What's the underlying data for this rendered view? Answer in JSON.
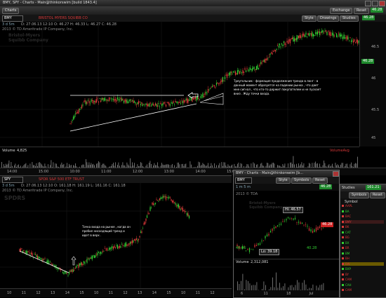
{
  "main_window": {
    "title": "BMY, SPY - Charts - Main@thinkorswim [build 1843.4]",
    "tab_symbol": "BRISTOL MYERS SQUIBB CO",
    "buttons": {
      "exchange": "Exchange",
      "style": "Style",
      "drawings": "Drawings",
      "studies": "Studies"
    },
    "price": "46.28"
  },
  "top_chart": {
    "symbol": "BMY",
    "interval": "3 d 5m",
    "ohlc": "D: 27.06.13 12:10   O: 46.27   H: 46.33   L: 46.27   C: 46.28",
    "copyright": "2013 © TD Ameritrade IP Company, Inc.",
    "watermark_lines": [
      "Bristol-Myers",
      "Squibb Company"
    ],
    "price_scale": [
      "46.5",
      "46",
      "45.5",
      "45",
      "44.5"
    ],
    "price_label": "46.28",
    "volume_label": "Volume",
    "volume_value": "4,825",
    "volume_right": "VolumeAvg",
    "time_axis": [
      "14:00",
      "15:00",
      "10:00",
      "11:00",
      "12:00",
      "13:00",
      "14:00",
      "15:00",
      "27",
      "10:00",
      "11:00"
    ],
    "annotation": "Треугольник - формация продолжения тренда в лонг - в данный момент образуется на падении рынка , что дает мне сигнал , что кто-то держит покупателем и не пускает вниз . Жду точки входа."
  },
  "bottom_chart": {
    "symbol": "SPY",
    "interval": "3 d 5m",
    "tab_symbol": "SPDR S&P 500 ETF TRUST",
    "ohlc": "D: 27.06.13 12:10   O: 161.18   H: 161.19   L: 161.16   C: 161.18",
    "copyright": "2013 © TD Ameritrade IP Company, Inc.",
    "watermark": "SPDRS",
    "time_axis": [
      "10",
      "11",
      "12",
      "13",
      "14",
      "15",
      "10",
      "11",
      "12",
      "13",
      "14",
      "15",
      "10",
      "11",
      "12"
    ],
    "annotation": "Точка входа на рынке , когда он пробил нисходящий тренд и идет в верх ."
  },
  "popup_window": {
    "title": "BMY - Charts - Main@thinkorswim [b...",
    "symbol": "BMY",
    "interval": "1 m 5 m",
    "buttons": {
      "style": "Style",
      "symbols": "Symbols",
      "reset": "Reset"
    },
    "price": "46.28",
    "copyright": "2013 © TDA",
    "watermark_lines": [
      "Bristol-Myers",
      "Squibb Company"
    ],
    "hi_label": "Hi: 46.57",
    "lo_label": "Lo: 39.18",
    "left_label": "40.06",
    "right_label": "40.28",
    "price_tag": "46.28",
    "volume_label": "Volume",
    "volume_value": "2,312,081",
    "time_axis": [
      "6",
      "11",
      "18",
      "Jul"
    ]
  },
  "studies_panel": {
    "title": "Studies",
    "price": "161.21",
    "buttons": {
      "symbols": "Symbols",
      "reset": "Reset"
    },
    "header": "Symbol",
    "rows": [
      {
        "sym": "AAPL",
        "color": "#d93838"
      },
      {
        "sym": "BA",
        "color": "#33cc33"
      },
      {
        "sym": "BAC",
        "color": "#d93838"
      },
      {
        "sym": "BMY",
        "color": "#d93838",
        "highlight": true
      },
      {
        "sym": "BK",
        "color": "#d93838"
      },
      {
        "sym": "CAT",
        "color": "#33cc33"
      },
      {
        "sym": "BG",
        "color": "#d93838"
      },
      {
        "sym": "BX",
        "color": "#33cc33"
      },
      {
        "sym": "BR",
        "color": "#d93838"
      },
      {
        "sym": "BM",
        "color": "#33cc33"
      },
      {
        "sym": "BH",
        "color": "#d93838"
      },
      {
        "sym": "BW",
        "color": "#d93838",
        "highlight_yellow": true
      },
      {
        "sym": "BXP",
        "color": "#33cc33"
      },
      {
        "sym": "BY",
        "color": "#d93838"
      },
      {
        "sym": "CAM",
        "color": "#d93838"
      },
      {
        "sym": "CAH",
        "color": "#33cc33"
      },
      {
        "sym": "CAM",
        "color": "#d93838"
      }
    ]
  },
  "colors": {
    "up": "#33cc33",
    "down": "#d93838",
    "accent": "#2a73c8"
  }
}
